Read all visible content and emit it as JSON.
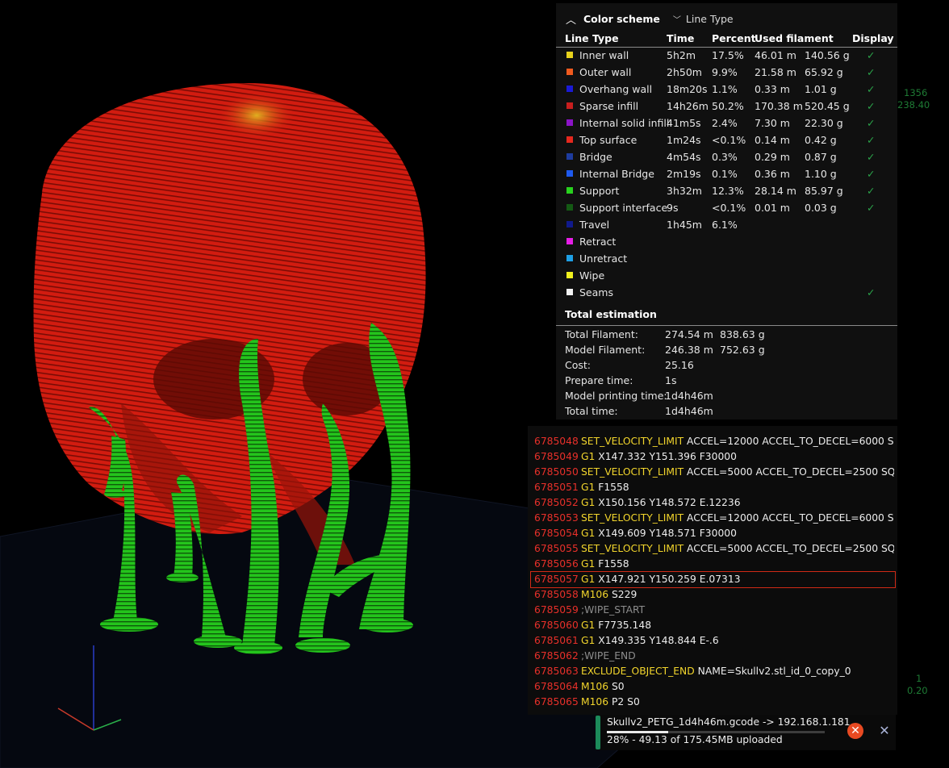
{
  "color_scheme": {
    "title": "Color scheme",
    "mode": "Line Type",
    "columns": [
      "Line Type",
      "Time",
      "Percent",
      "Used filament",
      "Display"
    ],
    "rows": [
      {
        "label": "Inner wall",
        "color": "#e8d21c",
        "time": "5h2m",
        "percent": "17.5%",
        "length": "46.01 m",
        "weight": "140.56 g",
        "display": true
      },
      {
        "label": "Outer wall",
        "color": "#f05a1e",
        "time": "2h50m",
        "percent": "9.9%",
        "length": "21.58 m",
        "weight": "65.92 g",
        "display": true
      },
      {
        "label": "Overhang wall",
        "color": "#1a1ad6",
        "time": "18m20s",
        "percent": "1.1%",
        "length": "0.33 m",
        "weight": "1.01 g",
        "display": true
      },
      {
        "label": "Sparse infill",
        "color": "#c81e1e",
        "time": "14h26m",
        "percent": "50.2%",
        "length": "170.38 m",
        "weight": "520.45 g",
        "display": true
      },
      {
        "label": "Internal solid infill",
        "color": "#8c14c8",
        "time": "41m5s",
        "percent": "2.4%",
        "length": "7.30 m",
        "weight": "22.30 g",
        "display": true
      },
      {
        "label": "Top surface",
        "color": "#e6281e",
        "time": "1m24s",
        "percent": "<0.1%",
        "length": "0.14 m",
        "weight": "0.42 g",
        "display": true
      },
      {
        "label": "Bridge",
        "color": "#1e3ca0",
        "time": "4m54s",
        "percent": "0.3%",
        "length": "0.29 m",
        "weight": "0.87 g",
        "display": true
      },
      {
        "label": "Internal Bridge",
        "color": "#1e5af0",
        "time": "2m19s",
        "percent": "0.1%",
        "length": "0.36 m",
        "weight": "1.10 g",
        "display": true
      },
      {
        "label": "Support",
        "color": "#28d21e",
        "time": "3h32m",
        "percent": "12.3%",
        "length": "28.14 m",
        "weight": "85.97 g",
        "display": true
      },
      {
        "label": "Support interface",
        "color": "#145a14",
        "time": "9s",
        "percent": "<0.1%",
        "length": "0.01 m",
        "weight": "0.03 g",
        "display": true
      },
      {
        "label": "Travel",
        "color": "#101a8c",
        "time": "1h45m",
        "percent": "6.1%",
        "length": "",
        "weight": "",
        "display": false
      },
      {
        "label": "Retract",
        "color": "#e61ee6",
        "time": "",
        "percent": "",
        "length": "",
        "weight": "",
        "display": false
      },
      {
        "label": "Unretract",
        "color": "#1ea0e6",
        "time": "",
        "percent": "",
        "length": "",
        "weight": "",
        "display": false
      },
      {
        "label": "Wipe",
        "color": "#f0f01e",
        "time": "",
        "percent": "",
        "length": "",
        "weight": "",
        "display": false
      },
      {
        "label": "Seams",
        "color": "#f2f2f2",
        "time": "",
        "percent": "",
        "length": "",
        "weight": "",
        "display": true
      }
    ]
  },
  "estimation": {
    "title": "Total estimation",
    "rows": [
      {
        "key": "Total Filament:",
        "v1": "274.54 m",
        "v2": "838.63 g"
      },
      {
        "key": "Model Filament:",
        "v1": "246.38 m",
        "v2": "752.63 g"
      },
      {
        "key": "Cost:",
        "v1": "25.16",
        "v2": ""
      },
      {
        "key": "Prepare time:",
        "v1": "1s",
        "v2": ""
      },
      {
        "key": "Model printing time:",
        "v1": "1d4h46m",
        "v2": ""
      },
      {
        "key": "Total time:",
        "v1": "1d4h46m",
        "v2": ""
      }
    ]
  },
  "gcode": {
    "selected_line": "6785057",
    "lines": [
      {
        "num": "6785048",
        "cmd": "SET_VELOCITY_LIMIT",
        "args": " ACCEL=12000 ACCEL_TO_DECEL=6000 S...",
        "comment": false
      },
      {
        "num": "6785049",
        "cmd": "G1",
        "args": " X147.332 Y151.396 F30000",
        "comment": false
      },
      {
        "num": "6785050",
        "cmd": "SET_VELOCITY_LIMIT",
        "args": " ACCEL=5000 ACCEL_TO_DECEL=2500 SQ...",
        "comment": false
      },
      {
        "num": "6785051",
        "cmd": "G1",
        "args": " F1558",
        "comment": false
      },
      {
        "num": "6785052",
        "cmd": "G1",
        "args": " X150.156 Y148.572 E.12236",
        "comment": false
      },
      {
        "num": "6785053",
        "cmd": "SET_VELOCITY_LIMIT",
        "args": " ACCEL=12000 ACCEL_TO_DECEL=6000 S...",
        "comment": false
      },
      {
        "num": "6785054",
        "cmd": "G1",
        "args": " X149.609 Y148.571 F30000",
        "comment": false
      },
      {
        "num": "6785055",
        "cmd": "SET_VELOCITY_LIMIT",
        "args": " ACCEL=5000 ACCEL_TO_DECEL=2500 SQ...",
        "comment": false
      },
      {
        "num": "6785056",
        "cmd": "G1",
        "args": " F1558",
        "comment": false
      },
      {
        "num": "6785057",
        "cmd": "G1",
        "args": " X147.921 Y150.259 E.07313",
        "comment": false
      },
      {
        "num": "6785058",
        "cmd": "M106",
        "args": " S229",
        "comment": false
      },
      {
        "num": "6785059",
        "cmd": ";WIPE_START",
        "args": "",
        "comment": true
      },
      {
        "num": "6785060",
        "cmd": "G1",
        "args": " F7735.148",
        "comment": false
      },
      {
        "num": "6785061",
        "cmd": "G1",
        "args": " X149.335 Y148.844 E-.6",
        "comment": false
      },
      {
        "num": "6785062",
        "cmd": ";WIPE_END",
        "args": "",
        "comment": true
      },
      {
        "num": "6785063",
        "cmd": "EXCLUDE_OBJECT_END",
        "args": " NAME=Skullv2.stl_id_0_copy_0",
        "comment": false
      },
      {
        "num": "6785064",
        "cmd": "M106",
        "args": " S0",
        "comment": false
      },
      {
        "num": "6785065",
        "cmd": "M106",
        "args": " P2 S0",
        "comment": false
      }
    ]
  },
  "upload": {
    "filename": "Skullv2_PETG_1d4h46m.gcode -> 192.168.1.181",
    "status": "28% - 49.13 of 175.45MB uploaded",
    "progress": 0.28,
    "cancel_icon": "cancel-circle-icon",
    "close_icon": "close-x-icon"
  },
  "layer_slider": {
    "top_layer": "1356",
    "top_height": "238.40",
    "bottom_layer": "1",
    "bottom_height": "0.20"
  },
  "colors": {
    "model_red": "#d81e10",
    "support_green": "#22c81a",
    "accent_check": "#2ba44a",
    "line_number": "#e8302a",
    "gcode_command": "#f2d52c"
  }
}
